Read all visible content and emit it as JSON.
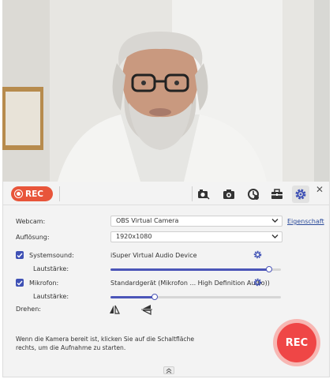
{
  "toolbar": {
    "rec_label": "REC",
    "icons": [
      "screenshot-icon",
      "camera-icon",
      "schedule-icon",
      "toolbox-icon",
      "gear-icon"
    ],
    "close": "✕"
  },
  "settings": {
    "webcam_label": "Webcam:",
    "webcam_value": "OBS Virtual Camera",
    "properties_link": "Eigenschaft",
    "resolution_label": "Auflösung:",
    "resolution_value": "1920x1080",
    "system_sound_label": "Systemsound:",
    "system_sound_device": "iSuper Virtual Audio Device",
    "system_volume_label": "Lautstärke:",
    "system_volume": 0.93,
    "mic_label": "Mikrofon:",
    "mic_device": "Standardgerät (Mikrofon ... High Definition Audio))",
    "mic_volume_label": "Lautstärke:",
    "mic_volume": 0.26,
    "rotate_label": "Drehen:"
  },
  "footer": {
    "hint": "Wenn die Kamera bereit ist, klicken Sie auf die Schaltfläche rechts, um die Aufnahme zu starten.",
    "big_rec_label": "REC"
  },
  "colors": {
    "accent": "#4b55b8",
    "rec_pill": "#e8553a",
    "rec_button": "#ef4646"
  }
}
